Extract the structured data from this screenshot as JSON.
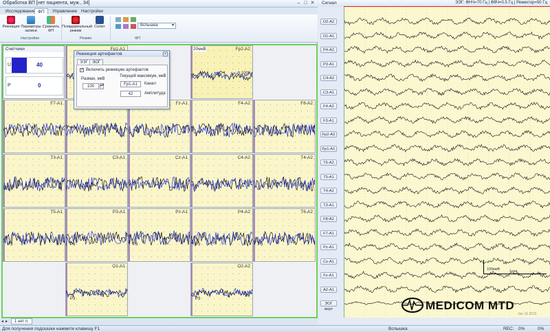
{
  "left_window": {
    "title": "Обработка ВП [нет пациента, муж., 34]",
    "tabs": [
      "Исследование",
      "ФП",
      "Управление",
      "Настройки"
    ],
    "active_tab": "ФП",
    "ribbon": {
      "buttons": [
        {
          "label": "Режекция",
          "icon": "rejection-icon"
        },
        {
          "label": "Параметры записи",
          "icon": "record-params-icon"
        },
        {
          "label": "Сравнить ФП",
          "icon": "compare-icon"
        },
        {
          "label": "Псевдореальный режим",
          "icon": "pseudo-real-icon"
        },
        {
          "label": "Сплит",
          "icon": "split-icon"
        }
      ],
      "groups": [
        "Настройки",
        "Режим",
        "ФП"
      ],
      "flash_select": "Вспышка"
    },
    "counters": {
      "title": "Счетчики",
      "u_label": "U",
      "u_value": "40",
      "p_label": "P",
      "p_value": "0"
    },
    "dialog": {
      "title": "Режекция артефактов",
      "tabs": [
        "ЭЭГ",
        "ЭОГ"
      ],
      "checkbox_label": "Включить режекцию артефактов",
      "range_label": "Размах, мкВ",
      "range_value": "100",
      "current_max_label": "Текущий максимум, мкВ",
      "channel_value": "Fp1-A1",
      "channel_label": "Канал",
      "amplitude_value": "42",
      "amplitude_label": "Амплитуда"
    },
    "panels": {
      "row0": [
        "Fp1-A1",
        "Fp2-A2"
      ],
      "row1": [
        "F7-A1",
        "F3-A1",
        "Fz-A1",
        "F4-A2",
        "F8-A2"
      ],
      "row2": [
        "T3-A1",
        "C3-A1",
        "Cz-A1",
        "C4-A2",
        "T4-A2"
      ],
      "row3": [
        "T5-A1",
        "P3-A1",
        "Pz-A1",
        "P4-A2",
        "T6-A2"
      ],
      "row4": [
        "O1-A1",
        "O2-A2"
      ],
      "scale_label": "20мкВ",
      "scale_value": "1000",
      "peak_label": "P3"
    },
    "bottom_tab": "1 нет п."
  },
  "right_window": {
    "title": "Сигнал",
    "header_info": "ЭЭГ: ФНЧ=70 Гц | ФВЧ=0.5 Гц | Режектор=50 Гц",
    "channels": [
      "O2-A2",
      "O1-A1",
      "P4-A2",
      "P3-A1",
      "C4-A2",
      "C3-A1",
      "F4-A2",
      "F3-A1",
      "Fp2-A2",
      "Fp1-A1",
      "T6-A2",
      "T5-A1",
      "T4-A2",
      "T3-A1",
      "F8-A2",
      "F7-A1",
      "Pz-A1",
      "Cz-A1",
      "Fz-A1",
      "A2-A1",
      "ЭОГ верт"
    ],
    "scale_amp": "100мкВ",
    "scale_time": "1сек",
    "logo_text": "MEDICOM MTD",
    "date": "Jan 16 2015"
  },
  "statusbar": {
    "hint": "Для получения подсказки нажмите клавишу F1",
    "mode": "Вспышка",
    "rec_label": "REC:",
    "rec_value": "0%",
    "percent": "0%"
  },
  "colors": {
    "panel_bg": "#fbf6c9",
    "trace_blue": "#1f2fd0",
    "trace_black": "#111111",
    "marker_purple": "#7a3fa8",
    "active_border": "#6ccf5a",
    "counter_bar": "#2323c8"
  }
}
